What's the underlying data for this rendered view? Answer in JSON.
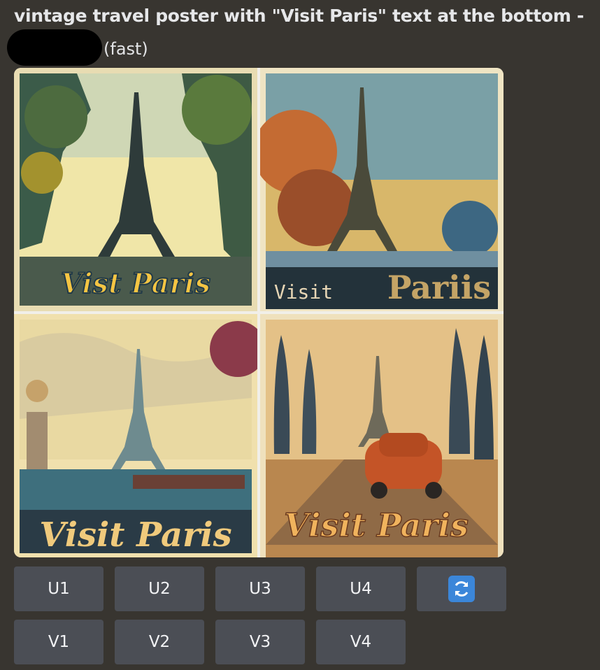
{
  "message": {
    "prompt": "vintage travel poster with \"Visit Paris\" text at the bottom -",
    "mode": "(fast)"
  },
  "images": [
    {
      "caption": "Vist Paris",
      "palette": {
        "sky": "#f0e6a8",
        "frame": "#e8dcb2",
        "text": "#f5c543",
        "outline": "#213a48"
      }
    },
    {
      "caption_left": "Visit",
      "caption_right": "Pariis",
      "palette": {
        "sky": "#d8b76a",
        "frame": "#efe4c3",
        "text": "#e7d6b5",
        "band": "#23323a"
      }
    },
    {
      "caption": "Visit Paris",
      "palette": {
        "sky": "#e9d9a2",
        "water": "#3e6f7d",
        "text": "#f0ca7c",
        "band": "#2a3b46"
      }
    },
    {
      "caption": "Visit Paris",
      "palette": {
        "sky": "#e4c187",
        "road": "#b9874f",
        "car": "#c45427",
        "text": "#f0b35d"
      }
    }
  ],
  "upscale_buttons": [
    "U1",
    "U2",
    "U3",
    "U4"
  ],
  "variation_buttons": [
    "V1",
    "V2",
    "V3",
    "V4"
  ],
  "reroll_icon": "refresh-icon",
  "colors": {
    "background": "#383530",
    "button": "#4b4e55",
    "reroll": "#3b86d9"
  }
}
